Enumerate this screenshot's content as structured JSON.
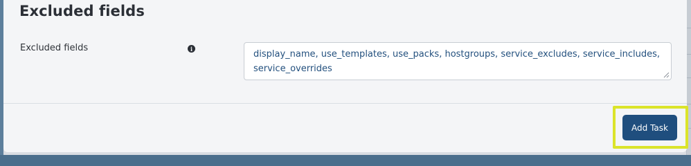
{
  "section": {
    "title": "Excluded fields"
  },
  "field": {
    "label": "Excluded fields",
    "info_icon": "info-circle-icon",
    "value": "display_name, use_templates, use_packs, hostgroups, service_excludes, service_includes, service_overrides"
  },
  "footer": {
    "add_task_label": "Add Task"
  },
  "colors": {
    "accent": "#1f4e7e",
    "highlight": "#dbe42a",
    "value_text": "#23507e"
  }
}
